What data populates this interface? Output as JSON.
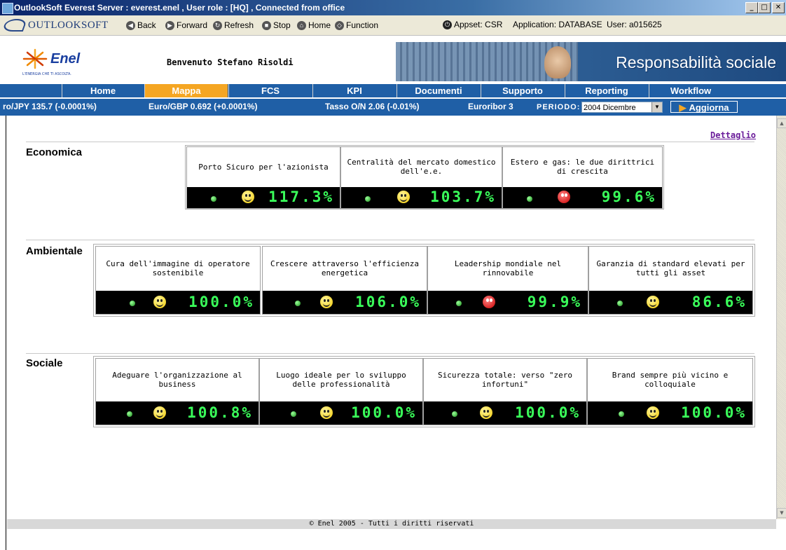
{
  "window": {
    "title": "OutlookSoft Everest    Server : everest.enel , User role : [HQ] , Connected from office",
    "controls": [
      "_",
      "□",
      "✕"
    ]
  },
  "toolbar": {
    "brand": "OUTLOOKSOFT",
    "buttons": [
      {
        "label": "Back",
        "icon": "back-icon"
      },
      {
        "label": "Forward",
        "icon": "forward-icon"
      },
      {
        "label": "Refresh",
        "icon": "refresh-icon"
      },
      {
        "label": "Stop",
        "icon": "stop-icon"
      },
      {
        "label": "Home",
        "icon": "home-icon"
      },
      {
        "label": "Function",
        "icon": "function-icon"
      }
    ],
    "appset": "Appset: CSR",
    "application": "Application: DATABASE",
    "user": "User: a015625"
  },
  "header": {
    "logo_text": "Enel",
    "logo_tagline": "L'ENERGIA CHE TI ASCOLTA.",
    "welcome": "Benvenuto Stefano Risoldi",
    "banner_title": "Responsabilità sociale"
  },
  "nav": {
    "tabs": [
      {
        "label": "Home",
        "active": false
      },
      {
        "label": "Mappa",
        "active": true
      },
      {
        "label": "FCS",
        "active": false
      },
      {
        "label": "KPI",
        "active": false
      },
      {
        "label": "Documenti",
        "active": false
      },
      {
        "label": "Supporto",
        "active": false
      },
      {
        "label": "Reporting",
        "active": false
      },
      {
        "label": "Workflow",
        "active": false
      }
    ]
  },
  "ticker": {
    "items": [
      "ro/JPY 135.7 (-0.0001%)",
      "Euro/GBP 0.692 (+0.0001%)",
      "Tasso O/N 2.06 (-0.01%)",
      "Euroribor 3"
    ],
    "periodo_label": "PERIODO:",
    "periodo_value": "2004 Dicembre",
    "aggiorna_label": "Aggiorna"
  },
  "content": {
    "dettaglio": "Dettaglio",
    "sections": [
      {
        "title": "Economica",
        "cards": [
          {
            "label": "Porto Sicuro per l'azionista",
            "value": "117.3%",
            "status": "happy"
          },
          {
            "label": "Centralità del mercato domestico dell'e.e.",
            "value": "103.7%",
            "status": "happy"
          },
          {
            "label": "Estero e gas: le due dirittrici di crescita",
            "value": "99.6%",
            "status": "sad"
          }
        ]
      },
      {
        "title": "Ambientale",
        "cards": [
          {
            "label": "Cura dell'immagine di operatore sostenibile",
            "value": "100.0%",
            "status": "happy"
          },
          {
            "label": "Crescere attraverso l'efficienza energetica",
            "value": "106.0%",
            "status": "happy"
          },
          {
            "label": "Leadership mondiale nel rinnovabile",
            "value": "99.9%",
            "status": "sad"
          },
          {
            "label": "Garanzia di standard elevati per tutti gli asset",
            "value": "86.6%",
            "status": "happy"
          }
        ]
      },
      {
        "title": "Sociale",
        "cards": [
          {
            "label": "Adeguare l'organizzazione al business",
            "value": "100.8%",
            "status": "happy"
          },
          {
            "label": "Luogo ideale per lo sviluppo delle professionalità",
            "value": "100.0%",
            "status": "happy"
          },
          {
            "label": "Sicurezza totale: verso \"zero infortuni\"",
            "value": "100.0%",
            "status": "happy"
          },
          {
            "label": "Brand sempre più vicino e colloquiale",
            "value": "100.0%",
            "status": "happy"
          }
        ]
      }
    ]
  },
  "footer": {
    "text": "© Enel 2005 - Tutti i diritti riservati"
  }
}
